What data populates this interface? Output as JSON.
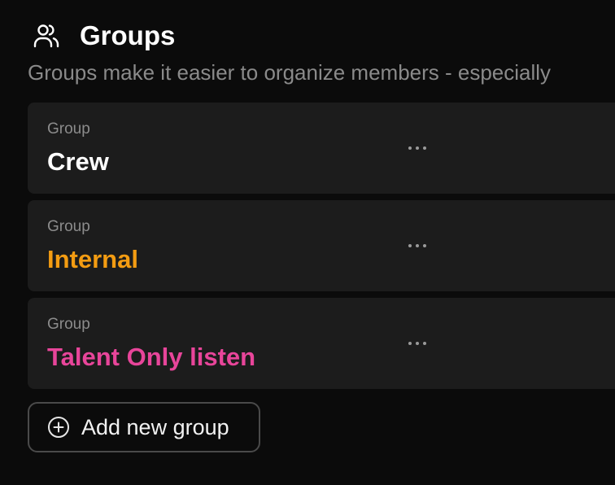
{
  "header": {
    "icon": "users-icon",
    "title": "Groups",
    "subtitle": "Groups make it easier to organize members - especially"
  },
  "groups": [
    {
      "type_label": "Group",
      "name": "Crew",
      "name_color": "#ffffff",
      "more_icon": "more-horizontal-icon"
    },
    {
      "type_label": "Group",
      "name": "Internal",
      "name_color": "#f39c12",
      "more_icon": "more-horizontal-icon"
    },
    {
      "type_label": "Group",
      "name": "Talent Only listen",
      "name_color": "#e8459a",
      "more_icon": "more-horizontal-icon"
    }
  ],
  "add_button": {
    "icon": "plus-circle-icon",
    "label": "Add new group"
  },
  "colors": {
    "background": "#0b0b0b",
    "card": "#1c1c1c",
    "muted_text": "#8a8a8a"
  }
}
